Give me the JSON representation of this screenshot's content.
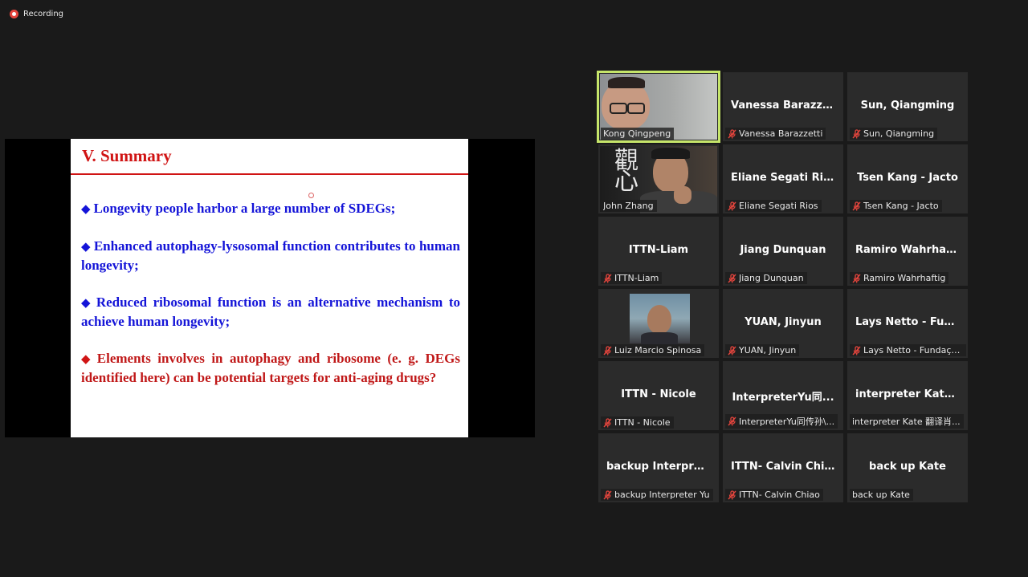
{
  "recording": {
    "label": "Recording"
  },
  "slide": {
    "title": "V. Summary",
    "bullets": [
      {
        "text": "Longevity people harbor a large number of SDEGs;",
        "color": "blue"
      },
      {
        "text": "Enhanced autophagy-lysosomal function contributes to human longevity;",
        "color": "blue"
      },
      {
        "text": "Reduced ribosomal function is an alternative mechanism to achieve human longevity;",
        "color": "blue"
      },
      {
        "text": "Elements involves in autophagy and ribosome (e. g. DEGs identified here) can be potential targets for anti-aging drugs?",
        "color": "red"
      }
    ],
    "bullet_glyph": "◆"
  },
  "participants": [
    {
      "center_name": "",
      "label": "Kong Qingpeng",
      "muted": false,
      "video": "kong",
      "active": true
    },
    {
      "center_name": "Vanessa  Barazze...",
      "label": "Vanessa Barazzetti",
      "muted": true
    },
    {
      "center_name": "Sun, Qiangming",
      "label": "Sun, Qiangming",
      "muted": true
    },
    {
      "center_name": "",
      "label": "John  Zhang",
      "muted": false,
      "video": "john"
    },
    {
      "center_name": "Eliane Segati Rios",
      "label": "Eliane Segati Rios",
      "muted": true
    },
    {
      "center_name": "Tsen Kang - Jacto",
      "label": "Tsen Kang - Jacto",
      "muted": true
    },
    {
      "center_name": "ITTN-Liam",
      "label": "ITTN-Liam",
      "muted": true
    },
    {
      "center_name": "Jiang Dunquan",
      "label": "Jiang Dunquan",
      "muted": true
    },
    {
      "center_name": "Ramiro  Wahrhaf...",
      "label": "Ramiro Wahrhaftig",
      "muted": true
    },
    {
      "center_name": "",
      "label": "Luiz Marcio Spinosa",
      "muted": true,
      "video": "avatar"
    },
    {
      "center_name": "YUAN, Jinyun",
      "label": "YUAN, Jinyun",
      "muted": true
    },
    {
      "center_name": "Lays Netto - Fun...",
      "label": "Lays Netto - Fundaçã...",
      "muted": true
    },
    {
      "center_name": "ITTN - Nicole",
      "label": "ITTN - Nicole",
      "muted": true
    },
    {
      "center_name": "InterpreterYu同...",
      "label": "InterpreterYu同传孙\\...",
      "muted": true
    },
    {
      "center_name": "interpreter  Kate...",
      "label": "interpreter Kate 翻译肖...",
      "muted": false
    },
    {
      "center_name": "backup  Interpre...",
      "label": "backup Interpreter Yu",
      "muted": true
    },
    {
      "center_name": "ITTN-  Calvin  Chi...",
      "label": "ITTN- Calvin Chiao",
      "muted": true
    },
    {
      "center_name": "back up Kate",
      "label": "back up Kate",
      "muted": false
    }
  ],
  "colors": {
    "background": "#1a1a1a",
    "tile": "#2b2b2b",
    "active_speaker": "#c6e56a",
    "muted": "#e5453d",
    "slide_blue": "#1414d8",
    "slide_red": "#c01818"
  }
}
